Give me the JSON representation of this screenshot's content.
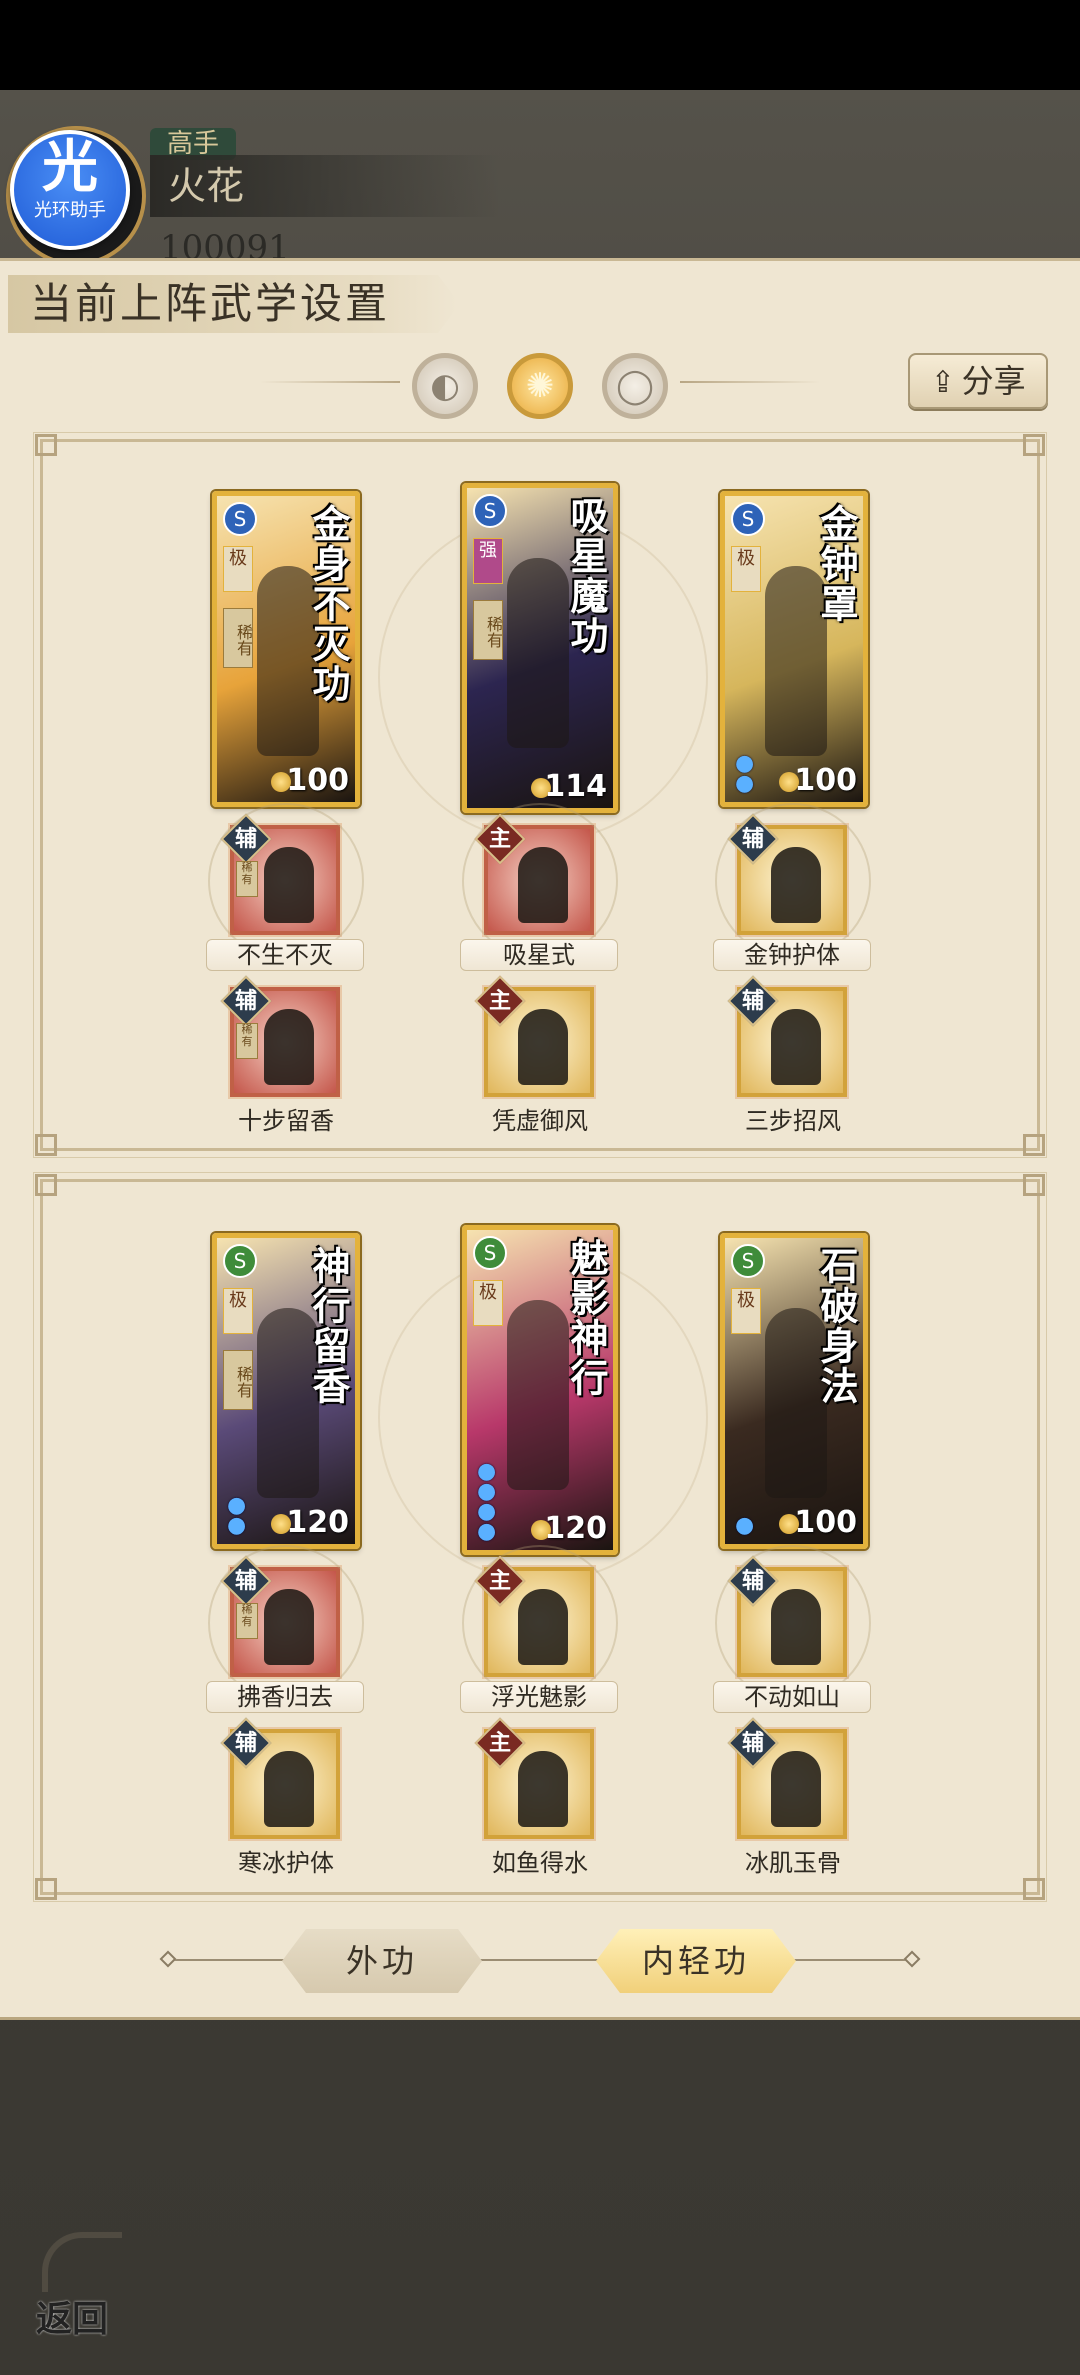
{
  "header": {
    "rank": "高手",
    "player_name": "火花",
    "coin_partial": "100091",
    "assistant_badge_glyph": "光",
    "assistant_badge_text": "光环助手"
  },
  "panel": {
    "title": "当前上阵武学设置",
    "share_label": "分享",
    "mode_icons": [
      "moon-icon",
      "sun-icon",
      "eclipse-icon"
    ],
    "active_mode_index": 1
  },
  "groups": [
    {
      "cards": [
        {
          "title": "金身不灭功",
          "badge": "S",
          "grade": "极",
          "rarity": "稀有",
          "cost": "100",
          "drops": 0,
          "art": "#e7a33a"
        },
        {
          "title": "吸星魔功",
          "badge": "S",
          "grade": "强",
          "rarity": "稀有",
          "cost": "114",
          "drops": 0,
          "art": "#2c2550"
        },
        {
          "title": "金钟罩",
          "badge": "S",
          "grade": "极",
          "rarity": "",
          "cost": "100",
          "drops": 2,
          "art": "#d6b65c"
        }
      ],
      "skills_row1": [
        {
          "type": "辅",
          "name": "不生不灭",
          "rarity": "稀有",
          "tone": "red"
        },
        {
          "type": "主",
          "name": "吸星式",
          "rarity": "",
          "tone": "red"
        },
        {
          "type": "辅",
          "name": "金钟护体",
          "rarity": "",
          "tone": "gold"
        }
      ],
      "skills_row2": [
        {
          "type": "辅",
          "name": "十步留香",
          "rarity": "稀有",
          "tone": "red"
        },
        {
          "type": "主",
          "name": "凭虚御风",
          "rarity": "",
          "tone": "gold"
        },
        {
          "type": "辅",
          "name": "三步招风",
          "rarity": "",
          "tone": "gold"
        }
      ]
    },
    {
      "cards": [
        {
          "title": "神行留香",
          "badge": "S",
          "grade": "极",
          "rarity": "稀有",
          "cost": "120",
          "drops": 2,
          "art": "#5a4a78"
        },
        {
          "title": "魅影神行",
          "badge": "S",
          "grade": "极",
          "rarity": "",
          "cost": "120",
          "drops": 4,
          "art": "#b8386a"
        },
        {
          "title": "石破身法",
          "badge": "S",
          "grade": "极",
          "rarity": "",
          "cost": "100",
          "drops": 1,
          "art": "#3a2a20"
        }
      ],
      "skills_row1": [
        {
          "type": "辅",
          "name": "拂香归去",
          "rarity": "稀有",
          "tone": "red"
        },
        {
          "type": "主",
          "name": "浮光魅影",
          "rarity": "",
          "tone": "gold"
        },
        {
          "type": "辅",
          "name": "不动如山",
          "rarity": "",
          "tone": "gold"
        }
      ],
      "skills_row2": [
        {
          "type": "辅",
          "name": "寒冰护体",
          "rarity": "",
          "tone": "gold"
        },
        {
          "type": "主",
          "name": "如鱼得水",
          "rarity": "",
          "tone": "gold"
        },
        {
          "type": "辅",
          "name": "冰肌玉骨",
          "rarity": "",
          "tone": "gold"
        }
      ]
    }
  ],
  "tabs": [
    {
      "label": "外功",
      "active": false
    },
    {
      "label": "内轻功",
      "active": true
    }
  ],
  "back_label": "返回"
}
